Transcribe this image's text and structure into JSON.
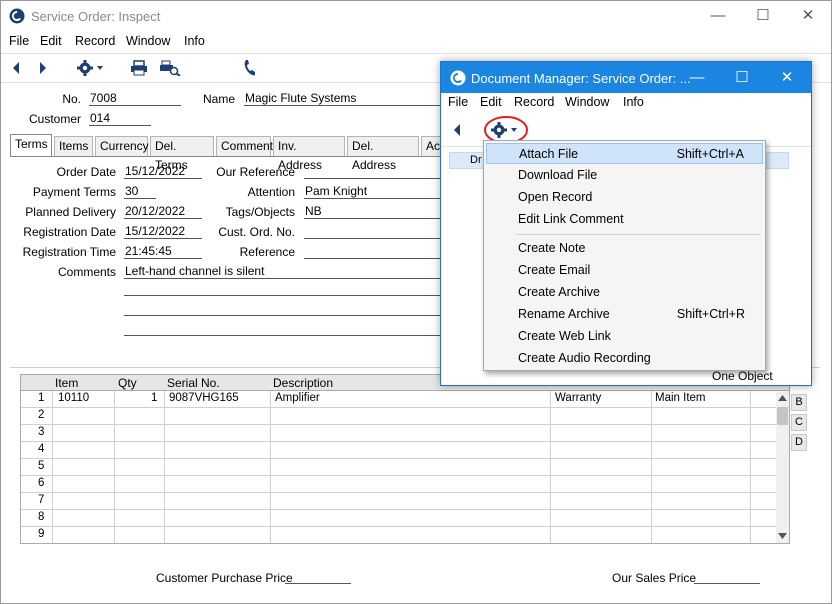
{
  "main_window": {
    "title": "Service Order: Inspect",
    "menu": [
      "File",
      "Edit",
      "Record",
      "Window",
      "Info"
    ],
    "header": {
      "no_label": "No.",
      "no_value": "7008",
      "name_label": "Name",
      "name_value": "Magic Flute Systems",
      "customer_label": "Customer",
      "customer_value": "014"
    },
    "tabs": [
      "Terms",
      "Items",
      "Currency",
      "Del. Terms",
      "Comment",
      "Inv. Address",
      "Del. Address",
      "Act"
    ],
    "fields": {
      "order_date_label": "Order Date",
      "order_date": "15/12/2022",
      "payment_terms_label": "Payment Terms",
      "payment_terms": "30",
      "planned_delivery_label": "Planned Delivery",
      "planned_delivery": "20/12/2022",
      "registration_date_label": "Registration Date",
      "registration_date": "15/12/2022",
      "registration_time_label": "Registration Time",
      "registration_time": "21:45:45",
      "comments_label": "Comments",
      "comments": "Left-hand channel is silent",
      "our_reference_label": "Our Reference",
      "our_reference": "",
      "attention_label": "Attention",
      "attention": "Pam Knight",
      "tags_label": "Tags/Objects",
      "tags": "NB",
      "cust_ord_label": "Cust. Ord. No.",
      "cust_ord": "",
      "reference_label": "Reference",
      "reference": ""
    },
    "grid": {
      "columns": [
        "Item",
        "Qty",
        "Serial No.",
        "Description"
      ],
      "rows": [
        {
          "n": "1",
          "item": "10110",
          "qty": "1",
          "serial": "9087VHG165",
          "desc": "Amplifier",
          "c5": "Warranty",
          "c6": "Main Item"
        },
        {
          "n": "2"
        },
        {
          "n": "3"
        },
        {
          "n": "4"
        },
        {
          "n": "5"
        },
        {
          "n": "6"
        },
        {
          "n": "7"
        },
        {
          "n": "8"
        },
        {
          "n": "9"
        }
      ],
      "side_tabs": [
        "B",
        "C",
        "D"
      ]
    },
    "footer": {
      "customer_purchase_price_label": "Customer Purchase Price",
      "our_sales_price_label": "Our Sales Price"
    }
  },
  "doc_manager": {
    "title": "Document Manager: Service Order: ...",
    "menu": [
      "File",
      "Edit",
      "Record",
      "Window",
      "Info"
    ],
    "list_header_fragment": "Dr",
    "status": "One Object"
  },
  "dropdown": {
    "items": [
      {
        "label": "Attach File",
        "shortcut": "Shift+Ctrl+A",
        "highlighted": true
      },
      {
        "label": "Download File",
        "shortcut": ""
      },
      {
        "label": "Open Record",
        "shortcut": ""
      },
      {
        "label": "Edit Link Comment",
        "shortcut": ""
      },
      {
        "label": "Create Note",
        "shortcut": ""
      },
      {
        "label": "Create Email",
        "shortcut": ""
      },
      {
        "label": "Create Archive",
        "shortcut": ""
      },
      {
        "label": "Rename Archive",
        "shortcut": "Shift+Ctrl+R"
      },
      {
        "label": "Create Web Link",
        "shortcut": ""
      },
      {
        "label": "Create Audio Recording",
        "shortcut": ""
      }
    ]
  },
  "colors": {
    "dm_titlebar": "#1a86e2",
    "highlight": "#cfe4f8",
    "annotation_circle": "#e02020"
  }
}
